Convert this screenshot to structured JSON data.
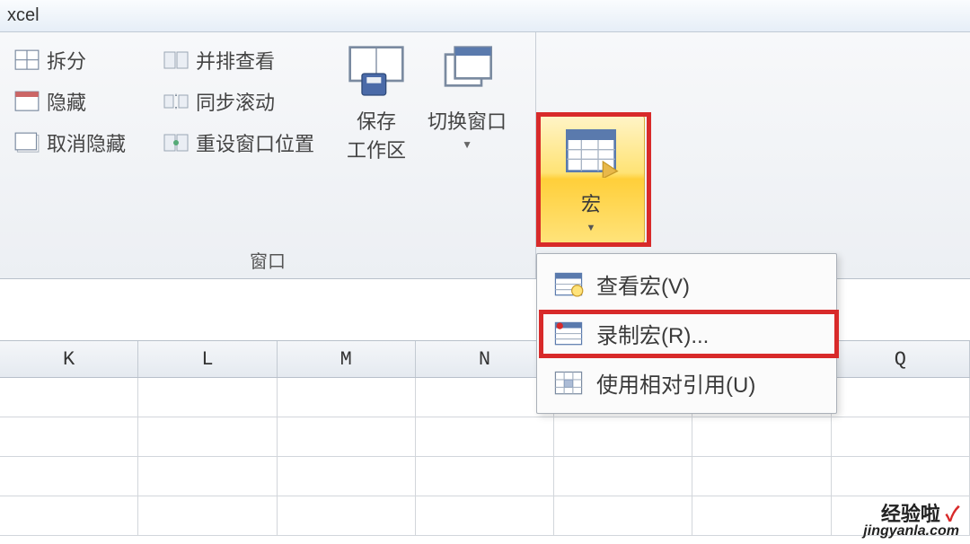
{
  "title": "xcel",
  "ribbon": {
    "window_group": {
      "label": "窗口",
      "col1": [
        {
          "icon": "split-icon",
          "label": "拆分"
        },
        {
          "icon": "hide-icon",
          "label": "隐藏"
        },
        {
          "icon": "unhide-icon",
          "label": "取消隐藏"
        }
      ],
      "col2": [
        {
          "icon": "side-by-side-icon",
          "label": "并排查看"
        },
        {
          "icon": "sync-scroll-icon",
          "label": "同步滚动"
        },
        {
          "icon": "reset-window-icon",
          "label": "重设窗口位置"
        }
      ],
      "save_workspace": {
        "label": "保存\n工作区"
      },
      "switch_windows": {
        "label": "切换窗口"
      }
    },
    "macro_group": {
      "label": "宏"
    }
  },
  "macro_menu": {
    "items": [
      {
        "icon": "view-macros-icon",
        "label": "查看宏(V)"
      },
      {
        "icon": "record-macro-icon",
        "label": "录制宏(R)..."
      },
      {
        "icon": "relative-ref-icon",
        "label": "使用相对引用(U)"
      }
    ]
  },
  "columns": [
    "K",
    "L",
    "M",
    "N",
    "",
    "",
    "Q"
  ],
  "watermark": {
    "line1": "经验啦",
    "check": "✓",
    "line2": "jingyanla.com"
  }
}
